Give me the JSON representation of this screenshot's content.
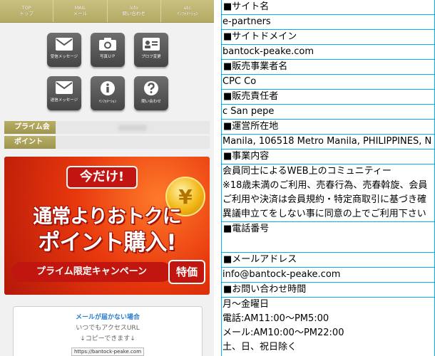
{
  "nav": [
    {
      "en": "TOP",
      "jp": "トップ"
    },
    {
      "en": "MAIL",
      "jp": "メール"
    },
    {
      "en": "info",
      "jp": "問い合わせ"
    },
    {
      "en": "etc",
      "jp": "ｲﾝﾌｫﾒｰｼｮﾝ"
    }
  ],
  "icons": [
    {
      "label": "受信メッセージ",
      "icon": "envelope-icon"
    },
    {
      "label": "写真ＵＰ",
      "icon": "camera-icon"
    },
    {
      "label": "プロフ変更",
      "icon": "id-card-icon"
    },
    {
      "label": "送信メッセージ",
      "icon": "envelope-icon"
    },
    {
      "label": "ｲﾝﾌｫﾒｰｼｮﾝ",
      "icon": "info-icon"
    },
    {
      "label": "問い合わせ",
      "icon": "question-icon"
    }
  ],
  "bars": {
    "prime": "プライム会員",
    "points": "ポイント"
  },
  "banner": {
    "ribbon": "今だけ!",
    "line1": "通常よりおトクに",
    "line2": "ポイント購入!",
    "campaign": "プライム限定キャンペーン",
    "badge": "特価",
    "coin": "¥"
  },
  "mailbox": {
    "title": "メールが届かない場合",
    "line1": "いつでもアクセスURL",
    "line2": "↓コピーできます↓",
    "url": "https://bantock-peake.com"
  },
  "info_rows": [
    {
      "head": "■サイト名",
      "value": "e-partners"
    },
    {
      "head": "■サイトドメイン",
      "value": "bantock-peake.com"
    },
    {
      "head": "■販売事業者名",
      "value": "CPC Co"
    },
    {
      "head": "■販売責任者",
      "value": "c San pepe"
    },
    {
      "head": "■運営所在地",
      "value": "Manila, 106518 Metro Manila, PHILIPPINES, N"
    },
    {
      "head": "■事業内容",
      "value": ""
    }
  ],
  "business_lines": [
    "会員同士によるWEB上のコミュニティー",
    "※18歳未満のご利用、売春行為、売春斡旋、会員",
    "ご利用や決済は会員規約・特定商取引に基づき確",
    "異議申立てをしない事に同意の上でご利用下さい"
  ],
  "phone_head": "■電話番号",
  "mail_head": "■メールアドレス",
  "mail_value": "info@bantock-peake.com",
  "hours_head": "■お問い合わせ時間",
  "hours_lines": [
    "月～金曜日",
    "電話:AM11:00～PM5:00",
    "メール:AM10:00～PM22:00",
    "土、日、祝日除く"
  ]
}
